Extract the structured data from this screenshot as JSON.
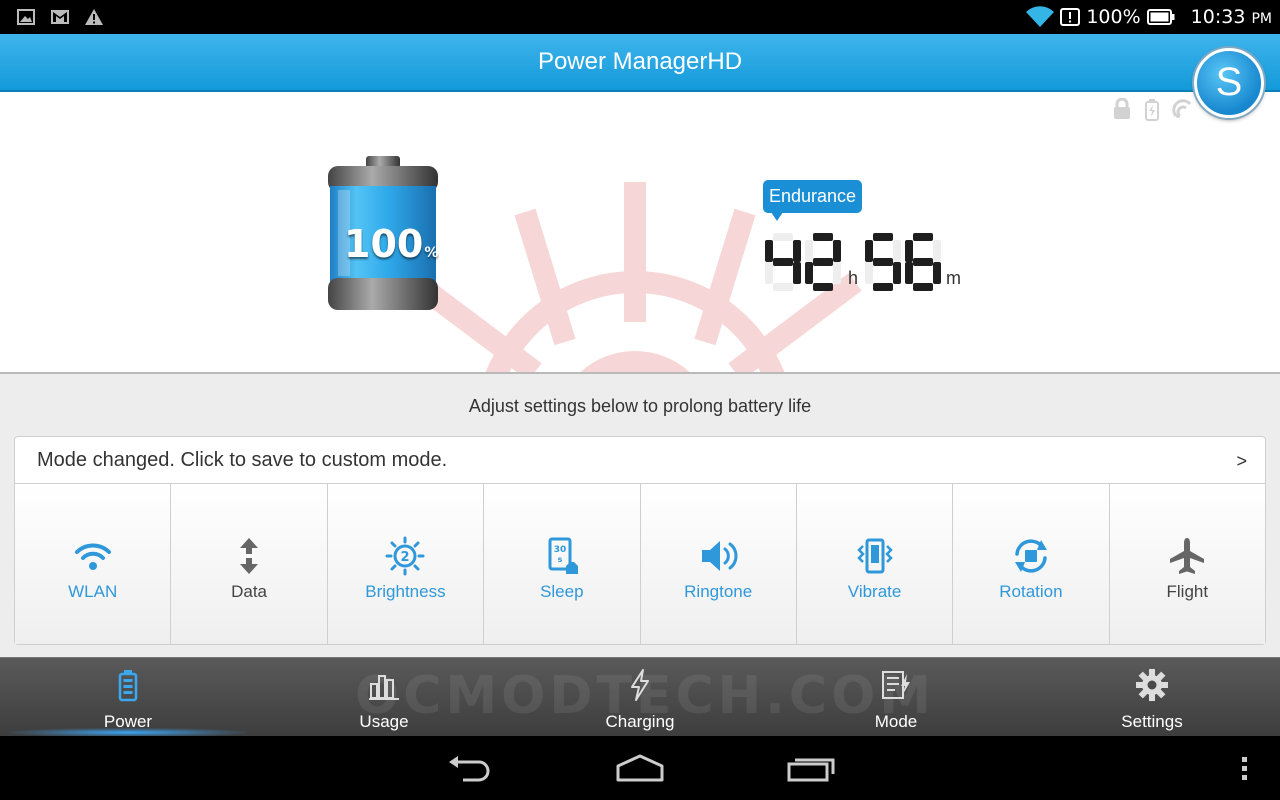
{
  "status_bar": {
    "battery_percent": "100%",
    "time": "10:33",
    "time_suffix": "PM",
    "left_icons": [
      "image-icon",
      "gmail-icon",
      "warning-icon"
    ],
    "right_icons": [
      "wifi-icon",
      "alert-icon",
      "battery-icon"
    ]
  },
  "app": {
    "title": "Power ManagerHD",
    "s_button": "S"
  },
  "battery": {
    "level_percent": 100,
    "level_label": "100",
    "percent_sign": "%"
  },
  "endurance": {
    "label": "Endurance",
    "hours": "42",
    "hours_unit": "h",
    "minutes": "56",
    "minutes_unit": "m"
  },
  "hint": "Adjust settings below to prolong battery life",
  "mode_bar": {
    "text": "Mode changed. Click to save to custom mode.",
    "arrow": ">"
  },
  "toggles": [
    {
      "label": "WLAN",
      "icon": "wifi-icon",
      "active": true
    },
    {
      "label": "Data",
      "icon": "data-icon",
      "active": false
    },
    {
      "label": "Brightness",
      "icon": "brightness-icon",
      "active": true
    },
    {
      "label": "Sleep",
      "icon": "sleep-icon",
      "active": true
    },
    {
      "label": "Ringtone",
      "icon": "speaker-icon",
      "active": true
    },
    {
      "label": "Vibrate",
      "icon": "vibrate-icon",
      "active": true
    },
    {
      "label": "Rotation",
      "icon": "rotation-icon",
      "active": true
    },
    {
      "label": "Flight",
      "icon": "airplane-icon",
      "active": false
    }
  ],
  "bottom_nav": [
    {
      "label": "Power",
      "icon": "battery-icon",
      "selected": true
    },
    {
      "label": "Usage",
      "icon": "bar-chart-icon",
      "selected": false
    },
    {
      "label": "Charging",
      "icon": "lightning-icon",
      "selected": false
    },
    {
      "label": "Mode",
      "icon": "mode-icon",
      "selected": false
    },
    {
      "label": "Settings",
      "icon": "gear-icon",
      "selected": false
    }
  ],
  "watermark_text": "OCMODTECH.COM",
  "colors": {
    "accent": "#1a8fd6",
    "active_label": "#2f98da",
    "inactive_label": "#444444"
  }
}
